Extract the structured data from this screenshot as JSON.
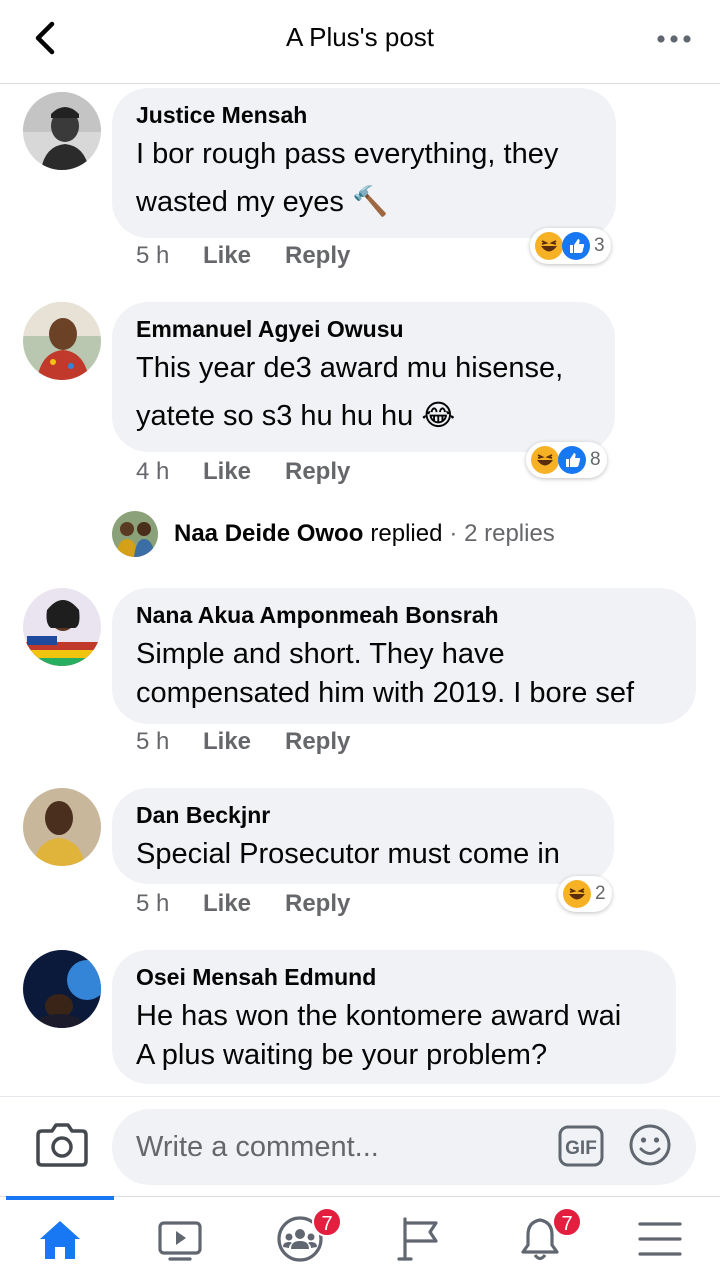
{
  "header": {
    "title": "A Plus's post"
  },
  "comments": [
    {
      "author": "Justice Mensah",
      "lines": [
        "I bor rough pass everything, they",
        "wasted my eyes 🔨"
      ],
      "time": "5 h",
      "like": "Like",
      "reply": "Reply",
      "reactions": {
        "icons": [
          "haha",
          "like"
        ],
        "count": "3"
      }
    },
    {
      "author": "Emmanuel Agyei Owusu",
      "lines": [
        "This year de3 award mu hisense,",
        "yatete so s3 hu hu hu 😂"
      ],
      "time": "4 h",
      "like": "Like",
      "reply": "Reply",
      "reactions": {
        "icons": [
          "haha",
          "like"
        ],
        "count": "8"
      },
      "replies": {
        "name": "Naa Deide Owoo",
        "verb": "replied",
        "summary": "· 2 replies"
      }
    },
    {
      "author": "Nana Akua Amponmeah Bonsrah",
      "lines": [
        "Simple and short. They have",
        "compensated him with 2019. I bore sef"
      ],
      "time": "5 h",
      "like": "Like",
      "reply": "Reply"
    },
    {
      "author": "Dan Beckjnr",
      "lines": [
        "Special Prosecutor must come in"
      ],
      "time": "5 h",
      "like": "Like",
      "reply": "Reply",
      "reactions": {
        "icons": [
          "haha"
        ],
        "count": "2"
      }
    },
    {
      "author": "Osei Mensah Edmund",
      "lines": [
        "He has won the kontomere award wai",
        "A plus waiting be your problem?"
      ]
    }
  ],
  "composer": {
    "placeholder": "Write a comment..."
  },
  "tabs": [
    {
      "name": "home",
      "badge": ""
    },
    {
      "name": "watch",
      "badge": ""
    },
    {
      "name": "groups",
      "badge": "7"
    },
    {
      "name": "pages",
      "badge": ""
    },
    {
      "name": "notifications",
      "badge": "7"
    },
    {
      "name": "menu",
      "badge": ""
    }
  ],
  "colors": {
    "accent": "#1877f2",
    "badge": "#e41e3f",
    "bubble": "#f0f2f5",
    "meta": "#65676b"
  }
}
